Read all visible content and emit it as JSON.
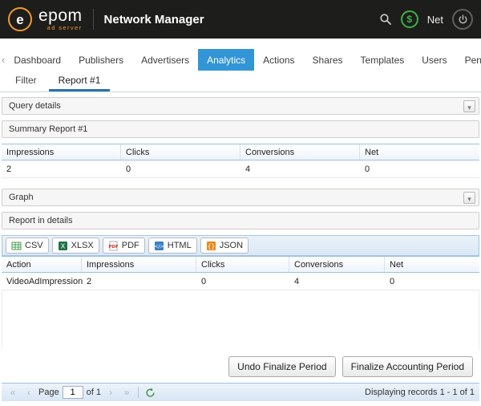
{
  "header": {
    "brand": "epom",
    "brand_sub": "ad server",
    "title": "Network Manager",
    "net_label": "Net"
  },
  "nav": {
    "items": [
      {
        "label": "Dashboard"
      },
      {
        "label": "Publishers"
      },
      {
        "label": "Advertisers"
      },
      {
        "label": "Analytics",
        "active": true
      },
      {
        "label": "Actions"
      },
      {
        "label": "Shares"
      },
      {
        "label": "Templates"
      },
      {
        "label": "Users"
      },
      {
        "label": "Pending Site"
      }
    ]
  },
  "tabs": [
    {
      "label": "Filter"
    },
    {
      "label": "Report #1",
      "active": true
    }
  ],
  "panels": {
    "query_details": "Query details",
    "summary_title": "Summary Report #1",
    "graph": "Graph",
    "report_details": "Report in details"
  },
  "summary_table": {
    "headers": [
      "Impressions",
      "Clicks",
      "Conversions",
      "Net"
    ],
    "row": [
      "2",
      "0",
      "4",
      "0"
    ]
  },
  "export": {
    "buttons": [
      {
        "label": "CSV"
      },
      {
        "label": "XLSX"
      },
      {
        "label": "PDF"
      },
      {
        "label": "HTML"
      },
      {
        "label": "JSON"
      }
    ]
  },
  "details_table": {
    "headers": [
      "Action",
      "Impressions",
      "Clicks",
      "Conversions",
      "Net"
    ],
    "row": [
      "VideoAdImpression",
      "2",
      "0",
      "4",
      "0"
    ]
  },
  "actions": {
    "undo_button": "Undo Finalize Period",
    "finalize_button": "Finalize Accounting Period"
  },
  "pagination": {
    "page_label": "Page",
    "page_value": "1",
    "of_label": "of 1",
    "status": "Displaying records 1 - 1 of 1"
  },
  "icons": {
    "search": "magnifier",
    "balance": "dollar-in-circle",
    "logout": "power-symbol",
    "collapse": "chevron-down",
    "first_page": "«",
    "prev_page": "‹",
    "next_page": "›",
    "last_page": "»",
    "refresh": "circular-arrow"
  },
  "colors": {
    "header_bg": "#1d1d1b",
    "accent_blue": "#3295d6",
    "brand_orange": "#ef9b2e",
    "brand_green": "#3fae49",
    "grid_border_blue": "#9cc1e3",
    "tab_underline": "#2a72ad"
  }
}
